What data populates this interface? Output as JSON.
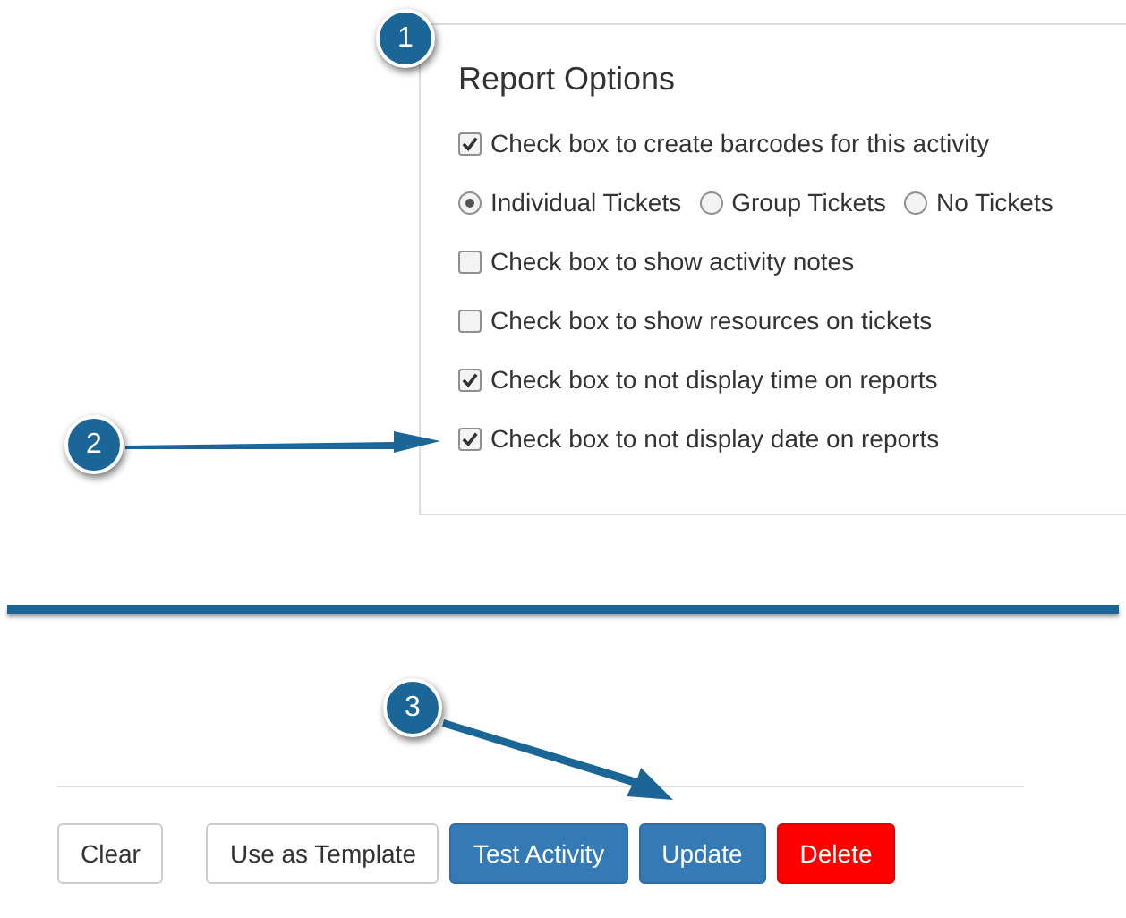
{
  "report_options": {
    "title": "Report Options",
    "options": [
      {
        "kind": "checkbox",
        "label": "Check box to create barcodes for this activity",
        "checked": true
      },
      {
        "kind": "radio_group",
        "choices": [
          {
            "label": "Individual Tickets",
            "selected": true
          },
          {
            "label": "Group Tickets",
            "selected": false
          },
          {
            "label": "No Tickets",
            "selected": false
          }
        ]
      },
      {
        "kind": "checkbox",
        "label": "Check box to show activity notes",
        "checked": false
      },
      {
        "kind": "checkbox",
        "label": "Check box to show resources on tickets",
        "checked": false
      },
      {
        "kind": "checkbox",
        "label": "Check box to not display time on reports",
        "checked": true
      },
      {
        "kind": "checkbox",
        "label": "Check box to not display date on reports",
        "checked": true
      }
    ]
  },
  "buttons": [
    {
      "kind": "default",
      "label": "Clear"
    },
    {
      "kind": "default",
      "label": "Use as Template"
    },
    {
      "kind": "primary",
      "label": "Test Activity"
    },
    {
      "kind": "primary",
      "label": "Update"
    },
    {
      "kind": "danger",
      "label": "Delete"
    }
  ],
  "annotations": [
    {
      "label": "1"
    },
    {
      "label": "2"
    },
    {
      "label": "3"
    }
  ]
}
